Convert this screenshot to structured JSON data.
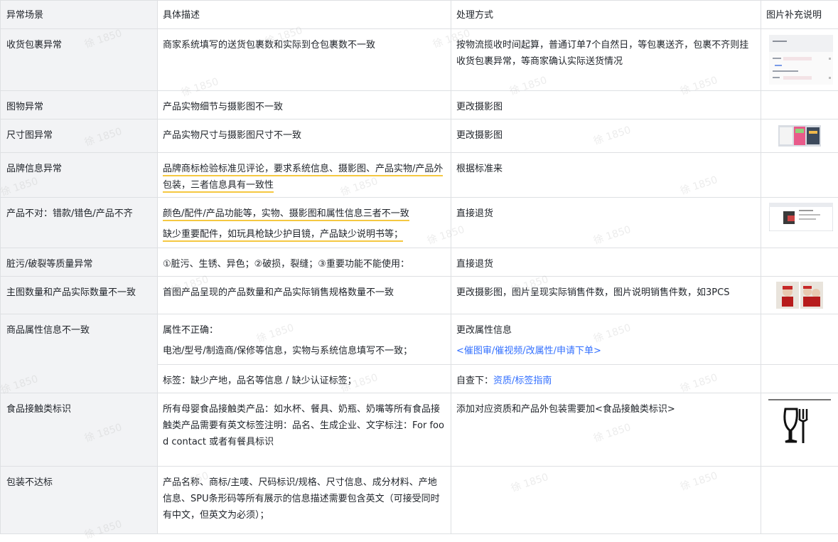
{
  "headers": [
    "异常场景",
    "具体描述",
    "处理方式",
    "图片补充说明"
  ],
  "watermark": "徐 1850",
  "rows": {
    "r1": {
      "scene": "收货包裹异常",
      "desc": "商家系统填写的送货包裹数和实际到仓包裹数不一致",
      "handle": "按物流揽收时间起算，普通订单7个自然日，等包裹送齐，包裹不齐则挂收货包裹异常，等商家确认实际送货情况",
      "img": "screenshot-thumbnail"
    },
    "r2": {
      "scene": "图物异常",
      "desc": "产品实物细节与摄影图不一致",
      "handle": "更改摄影图"
    },
    "r3": {
      "scene": "尺寸图异常",
      "desc": "产品实物尺寸与摄影图尺寸不一致",
      "handle": "更改摄影图",
      "img": "size-chart-thumbnail"
    },
    "r4": {
      "scene": "品牌信息异常",
      "desc": "品牌商标检验标准见评论，要求系统信息、摄影图、产品实物/产品外包装，三者信息具有一致性",
      "handle": "根据标准来"
    },
    "r5": {
      "scene": "产品不对：错款/错色/产品不齐",
      "desc1": "颜色/配件/产品功能等，实物、摄影图和属性信息三者不一致",
      "desc2": "缺少重要配件，如玩具枪缺少护目镜，产品缺少说明书等；",
      "handle": "直接退货",
      "img": "product-page-thumbnail"
    },
    "r6": {
      "scene": "脏污/破裂等质量异常",
      "desc": "①脏污、生锈、异色；②破损，裂缝；③重要功能不能使用：",
      "handle": "直接退货"
    },
    "r7": {
      "scene": "主图数量和产品实际数量不一致",
      "desc": "首图产品呈现的产品数量和产品实际销售规格数量不一致",
      "handle": "更改摄影图，图片呈现实际销售件数，图片说明销售件数，如3PCS",
      "img": "product-photos"
    },
    "r8": {
      "scene": "商品属性信息不一致",
      "desc1": "属性不正确：",
      "desc2": "电池/型号/制造商/保修等信息，实物与系统信息填写不一致；",
      "handle1": "更改属性信息",
      "handle2": "<催图审/催视频/改属性/申请下单>"
    },
    "r9": {
      "desc": "标签：缺少产地，品名等信息 / 缺少认证标签；",
      "handle_prefix": "自查下：",
      "handle_link": "资质/标签指南"
    },
    "r10": {
      "scene": "食品接触类标识",
      "desc": "所有母婴食品接触类产品：如水杯、餐具、奶瓶、奶嘴等所有食品接触类产品需要有英文标签注明：品名、生成企业、文字标注：For food contact 或者有餐具标识",
      "handle": "添加对应资质和产品外包装需要加<食品接触类标识>",
      "img": "food-contact-symbol-icon"
    },
    "r11": {
      "scene": "包装不达标",
      "desc": "产品名称、商标/主唛、尺码标识/规格、尺寸信息、成分材料、产地信息、SPU条形码等所有展示的信息描述需要包含英文（可接受同时有中文，但英文为必须）；"
    }
  }
}
